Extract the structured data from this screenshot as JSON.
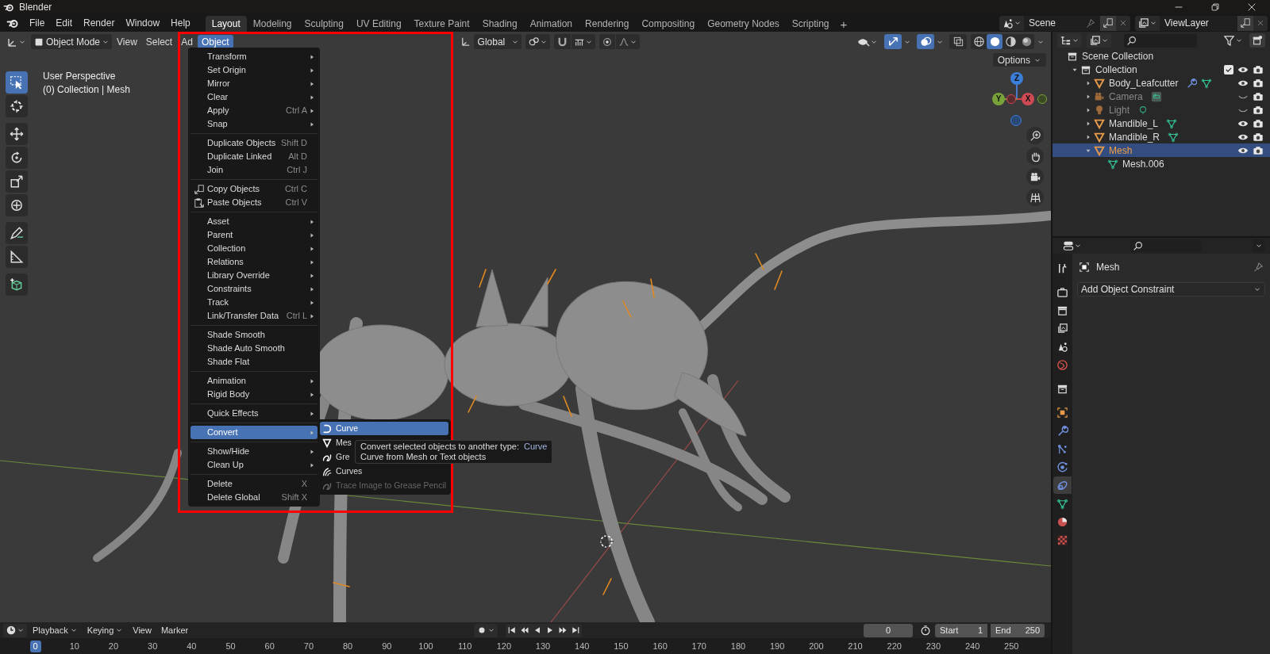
{
  "window": {
    "title": "Blender",
    "controls": [
      {
        "kind": "minimize"
      },
      {
        "kind": "restore"
      },
      {
        "kind": "close"
      }
    ]
  },
  "menu_bar": [
    "File",
    "Edit",
    "Render",
    "Window",
    "Help"
  ],
  "workspaces": [
    {
      "label": "Layout",
      "selected": true
    },
    {
      "label": "Modeling",
      "selected": false
    },
    {
      "label": "Sculpting",
      "selected": false
    },
    {
      "label": "UV Editing",
      "selected": false
    },
    {
      "label": "Texture Paint",
      "selected": false
    },
    {
      "label": "Shading",
      "selected": false
    },
    {
      "label": "Animation",
      "selected": false
    },
    {
      "label": "Rendering",
      "selected": false
    },
    {
      "label": "Compositing",
      "selected": false
    },
    {
      "label": "Geometry Nodes",
      "selected": false
    },
    {
      "label": "Scripting",
      "selected": false
    }
  ],
  "add_workspace": "+",
  "scene": "Scene",
  "view_layer": "ViewLayer",
  "viewport": {
    "header": {
      "mode": "Object Mode",
      "menus": [
        {
          "label": "View",
          "selected": false
        },
        {
          "label": "Select",
          "selected": false
        },
        {
          "label": "Ad",
          "selected": false
        },
        {
          "label": "Object",
          "selected": true
        }
      ],
      "orientation": "Global",
      "toggles": [
        {
          "kind": "gizmos",
          "on": true
        },
        {
          "kind": "overlays",
          "on": true
        },
        {
          "kind": "xray",
          "on": false
        }
      ],
      "shading": [
        {
          "kind": "wireframe",
          "selected": false
        },
        {
          "kind": "solid",
          "selected": true
        },
        {
          "kind": "material",
          "selected": false
        },
        {
          "kind": "rendered",
          "selected": false
        }
      ]
    },
    "options": "Options",
    "info": [
      "User Perspective",
      "(0) Collection | Mesh"
    ],
    "tools": [
      [
        {
          "kind": "select_box",
          "selected": true
        },
        {
          "kind": "cursor",
          "selected": false
        }
      ],
      [
        {
          "kind": "move",
          "selected": false
        },
        {
          "kind": "rotate",
          "selected": false
        },
        {
          "kind": "scale",
          "selected": false
        },
        {
          "kind": "transform",
          "selected": false
        }
      ],
      [
        {
          "kind": "annotate",
          "selected": false
        },
        {
          "kind": "measure",
          "selected": false
        }
      ],
      [
        {
          "kind": "add_cube",
          "selected": false
        }
      ]
    ],
    "gizmo": [
      "Z",
      "Y",
      "X"
    ],
    "object_menu": [
      [
        {
          "label": "Transform",
          "submenu": true,
          "selected": false
        },
        {
          "label": "Set Origin",
          "submenu": true,
          "selected": false
        },
        {
          "label": "Mirror",
          "submenu": true,
          "selected": false
        },
        {
          "label": "Clear",
          "submenu": true,
          "selected": false
        },
        {
          "label": "Apply",
          "shortcut": "Ctrl A",
          "submenu": true,
          "selected": false
        },
        {
          "label": "Snap",
          "submenu": true,
          "selected": false
        }
      ],
      [
        {
          "label": "Duplicate Objects",
          "shortcut": "Shift D",
          "submenu": false,
          "selected": false
        },
        {
          "label": "Duplicate Linked",
          "shortcut": "Alt D",
          "submenu": false,
          "selected": false
        },
        {
          "label": "Join",
          "shortcut": "Ctrl J",
          "submenu": false,
          "selected": false
        }
      ],
      [
        {
          "label": "Copy Objects",
          "shortcut": "Ctrl C",
          "submenu": false,
          "selected": false
        },
        {
          "label": "Paste Objects",
          "shortcut": "Ctrl V",
          "submenu": false,
          "selected": false
        }
      ],
      [
        {
          "label": "Asset",
          "submenu": true,
          "selected": false
        },
        {
          "label": "Parent",
          "submenu": true,
          "selected": false
        },
        {
          "label": "Collection",
          "submenu": true,
          "selected": false
        },
        {
          "label": "Relations",
          "submenu": true,
          "selected": false
        },
        {
          "label": "Library Override",
          "submenu": true,
          "selected": false
        },
        {
          "label": "Constraints",
          "submenu": true,
          "selected": false
        },
        {
          "label": "Track",
          "submenu": true,
          "selected": false
        },
        {
          "label": "Link/Transfer Data",
          "shortcut": "Ctrl L",
          "submenu": true,
          "selected": false
        }
      ],
      [
        {
          "label": "Shade Smooth",
          "submenu": false,
          "selected": false
        },
        {
          "label": "Shade Auto Smooth",
          "submenu": false,
          "selected": false
        },
        {
          "label": "Shade Flat",
          "submenu": false,
          "selected": false
        }
      ],
      [
        {
          "label": "Animation",
          "submenu": true,
          "selected": false
        },
        {
          "label": "Rigid Body",
          "submenu": true,
          "selected": false
        }
      ],
      [
        {
          "label": "Quick Effects",
          "submenu": true,
          "selected": false
        }
      ],
      [
        {
          "label": "Convert",
          "submenu": true,
          "selected": true
        }
      ],
      [
        {
          "label": "Show/Hide",
          "submenu": true,
          "selected": false
        },
        {
          "label": "Clean Up",
          "submenu": true,
          "selected": false
        }
      ],
      [
        {
          "label": "Delete",
          "shortcut": "X",
          "submenu": false,
          "selected": false
        },
        {
          "label": "Delete Global",
          "shortcut": "Shift X",
          "submenu": false,
          "selected": false
        }
      ]
    ],
    "convert_menu": [
      {
        "label": "Curve",
        "selected": true,
        "disabled": false
      },
      {
        "label": "Mes",
        "selected": false,
        "disabled": false
      },
      {
        "label": "Gre",
        "selected": false,
        "disabled": false
      },
      {
        "label": "Curves",
        "selected": false,
        "disabled": false
      },
      {
        "label": "Trace Image to Grease Pencil",
        "selected": false,
        "disabled": true
      }
    ],
    "tooltip": {
      "text": "Convert selected objects to another type:",
      "value": "Curve",
      "description": "Curve from Mesh or Text objects"
    }
  },
  "outliner": {
    "tree": [
      {
        "label": "Scene Collection",
        "kind": "scene_collection",
        "selected": false,
        "children": [
          {
            "label": "Collection",
            "kind": "collection",
            "expanded": true,
            "selected": false,
            "checked": true,
            "visible": true,
            "children": [
              {
                "label": "Body_Leafcutter",
                "kind": "mesh",
                "expanded": false,
                "selected": false,
                "visible": true,
                "modifiers": true
              },
              {
                "label": "Camera",
                "kind": "camera",
                "expanded": false,
                "selected": false,
                "visible": false,
                "modifiers": false
              },
              {
                "label": "Light",
                "kind": "light",
                "expanded": false,
                "selected": false,
                "visible": false,
                "modifiers": false
              },
              {
                "label": "Mandible_L",
                "kind": "mesh",
                "expanded": false,
                "selected": false,
                "visible": true,
                "modifiers": false
              },
              {
                "label": "Mandible_R",
                "kind": "mesh",
                "expanded": false,
                "selected": false,
                "visible": true,
                "modifiers": false
              },
              {
                "label": "Mesh",
                "kind": "mesh",
                "expanded": true,
                "selected": true,
                "visible": true,
                "modifiers": false,
                "children": [
                  {
                    "label": "Mesh.006",
                    "kind": "mesh_data",
                    "selected": false
                  }
                ]
              }
            ]
          }
        ]
      }
    ]
  },
  "properties": {
    "tabs": [
      [
        {
          "kind": "tool",
          "selected": false
        }
      ],
      [
        {
          "kind": "render",
          "selected": false
        },
        {
          "kind": "output",
          "selected": false
        },
        {
          "kind": "view_layer",
          "selected": false
        },
        {
          "kind": "scene",
          "selected": false
        },
        {
          "kind": "world",
          "selected": false
        }
      ],
      [
        {
          "kind": "collection",
          "selected": false
        }
      ],
      [
        {
          "kind": "object",
          "selected": false
        },
        {
          "kind": "modifiers",
          "selected": false
        },
        {
          "kind": "particles",
          "selected": false
        },
        {
          "kind": "physics",
          "selected": false
        },
        {
          "kind": "constraints",
          "selected": true
        },
        {
          "kind": "data",
          "selected": false
        },
        {
          "kind": "material",
          "selected": false
        },
        {
          "kind": "texture",
          "selected": false
        }
      ]
    ],
    "object_name": "Mesh",
    "add_constraint": "Add Object Constraint"
  },
  "timeline": {
    "menus": [
      {
        "label": "Playback",
        "dropdown": true
      },
      {
        "label": "Keying",
        "dropdown": true
      },
      {
        "label": "View",
        "dropdown": false
      },
      {
        "label": "Marker",
        "dropdown": false
      }
    ],
    "current_frame": "0",
    "start_label": "Start",
    "start": "1",
    "end_label": "End",
    "end": "250",
    "ruler": [
      {
        "label": "0",
        "selected": true
      },
      {
        "label": "10",
        "selected": false
      },
      {
        "label": "20",
        "selected": false
      },
      {
        "label": "30",
        "selected": false
      },
      {
        "label": "40",
        "selected": false
      },
      {
        "label": "50",
        "selected": false
      },
      {
        "label": "60",
        "selected": false
      },
      {
        "label": "70",
        "selected": false
      },
      {
        "label": "80",
        "selected": false
      },
      {
        "label": "90",
        "selected": false
      },
      {
        "label": "100",
        "selected": false
      },
      {
        "label": "110",
        "selected": false
      },
      {
        "label": "120",
        "selected": false
      },
      {
        "label": "130",
        "selected": false
      },
      {
        "label": "140",
        "selected": false
      },
      {
        "label": "150",
        "selected": false
      },
      {
        "label": "160",
        "selected": false
      },
      {
        "label": "170",
        "selected": false
      },
      {
        "label": "180",
        "selected": false
      },
      {
        "label": "190",
        "selected": false
      },
      {
        "label": "200",
        "selected": false
      },
      {
        "label": "210",
        "selected": false
      },
      {
        "label": "220",
        "selected": false
      },
      {
        "label": "230",
        "selected": false
      },
      {
        "label": "240",
        "selected": false
      },
      {
        "label": "250",
        "selected": false
      }
    ]
  }
}
